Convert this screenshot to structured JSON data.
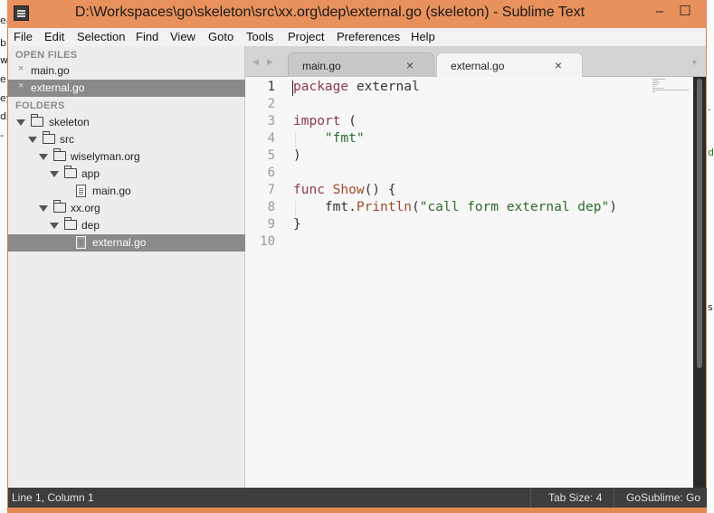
{
  "window": {
    "title": "D:\\Workspaces\\go\\skeleton\\src\\xx.org\\dep\\external.go (skeleton) - Sublime Text",
    "minimize_glyph": "–",
    "maximize_glyph": "☐"
  },
  "menu": [
    "File",
    "Edit",
    "Selection",
    "Find",
    "View",
    "Goto",
    "Tools",
    "Project",
    "Preferences",
    "Help"
  ],
  "sidebar": {
    "open_files_header": "OPEN FILES",
    "open_files": [
      {
        "label": "main.go",
        "close": "×"
      },
      {
        "label": "external.go",
        "close": "×"
      }
    ],
    "folders_header": "FOLDERS",
    "tree": [
      {
        "label": "skeleton",
        "type": "folder"
      },
      {
        "label": "src",
        "type": "folder"
      },
      {
        "label": "wiselyman.org",
        "type": "folder"
      },
      {
        "label": "app",
        "type": "folder"
      },
      {
        "label": "main.go",
        "type": "file"
      },
      {
        "label": "xx.org",
        "type": "folder"
      },
      {
        "label": "dep",
        "type": "folder"
      },
      {
        "label": "external.go",
        "type": "file"
      }
    ]
  },
  "tabs": [
    {
      "label": "main.go",
      "close": "×"
    },
    {
      "label": "external.go",
      "close": "×"
    }
  ],
  "editor": {
    "line_numbers": [
      "1",
      "2",
      "3",
      "4",
      "5",
      "6",
      "7",
      "8",
      "9",
      "10"
    ],
    "code": {
      "l1_kw": "package",
      "l1_rest": " external",
      "l3_kw": "import",
      "l3_rest": " (",
      "l4_str": "\"fmt\"",
      "l5": ")",
      "l7_kw": "func",
      "l7_fn": "Show",
      "l7_rest": "() {",
      "l8_pre": "fmt.",
      "l8_fn": "Println",
      "l8_open": "(",
      "l8_str": "\"call form external dep\"",
      "l8_close": ")",
      "l9": "}"
    }
  },
  "status": {
    "position": "Line 1, Column 1",
    "tab_size": "Tab Size: 4",
    "syntax": "GoSublime: Go"
  },
  "background_fragments": {
    "left": [
      "ea",
      "b",
      "w",
      "e",
      "ey",
      "ds",
      "-"
    ],
    "right": [
      ".",
      "de",
      "s"
    ]
  },
  "colors": {
    "title_bar": "#e8915c",
    "keyword": "#8b3a4a",
    "string": "#2e6b2e",
    "function": "#a04a2a",
    "status_bar": "#3e3e3e"
  }
}
